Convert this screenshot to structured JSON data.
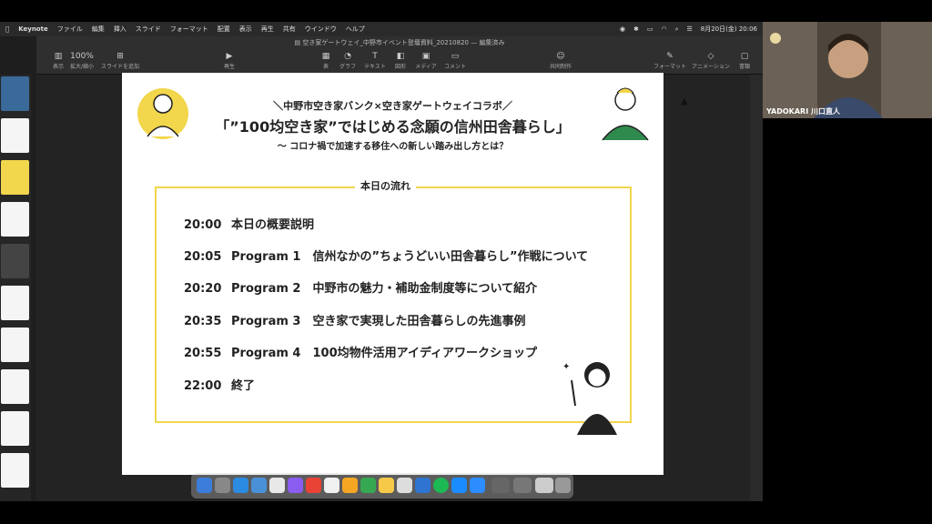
{
  "menubar": {
    "app_name": "Keynote",
    "items": [
      "ファイル",
      "編集",
      "挿入",
      "スライド",
      "フォーマット",
      "配置",
      "表示",
      "再生",
      "共有",
      "ウインドウ",
      "ヘルプ"
    ],
    "datetime": "8月20日(金) 20:06"
  },
  "window": {
    "title": "空き家ゲートウェイ_中野市イベント登壇資料_20210820",
    "edited": "— 編集済み"
  },
  "toolbar": {
    "zoom": "100%",
    "items": [
      {
        "icon": "sidebar-icon",
        "label": "表示"
      },
      {
        "icon": "zoom-icon",
        "label": "拡大/縮小"
      },
      {
        "icon": "add-slide-icon",
        "label": "スライドを追加"
      },
      {
        "icon": "play-icon",
        "label": "再生"
      },
      {
        "icon": "table-icon",
        "label": "表"
      },
      {
        "icon": "chart-icon",
        "label": "グラフ"
      },
      {
        "icon": "text-icon",
        "label": "テキスト"
      },
      {
        "icon": "shape-icon",
        "label": "図形"
      },
      {
        "icon": "media-icon",
        "label": "メディア"
      },
      {
        "icon": "comment-icon",
        "label": "コメント"
      },
      {
        "icon": "collaborate-icon",
        "label": "共同制作"
      },
      {
        "icon": "format-icon",
        "label": "フォーマット"
      },
      {
        "icon": "animate-icon",
        "label": "アニメーション"
      },
      {
        "icon": "document-icon",
        "label": "書類"
      }
    ]
  },
  "slide": {
    "subtitle_top": "＼中野市空き家バンク×空き家ゲートウェイコラボ／",
    "title": "「”100均空き家”ではじめる念願の信州田舎暮らし」",
    "subtitle_bottom": "〜 コロナ禍で加速する移住への新しい踏み出し方とは？",
    "section_title": "本日の流れ",
    "schedule": [
      {
        "time": "20:00",
        "text": "本日の概要説明"
      },
      {
        "time": "20:05",
        "text": "Program 1　信州なかの”ちょうどいい田舎暮らし”作戦について"
      },
      {
        "time": "20:20",
        "text": "Program 2　中野市の魅力・補助金制度等について紹介"
      },
      {
        "time": "20:35",
        "text": "Program 3　空き家で実現した田舎暮らしの先進事例"
      },
      {
        "time": "20:55",
        "text": "Program 4　100均物件活用アイディアワークショップ"
      },
      {
        "time": "22:00",
        "text": "終了"
      }
    ]
  },
  "webcam": {
    "name_label": "YADOKARI 川口直人"
  },
  "colors": {
    "accent_yellow": "#f2d64b",
    "slide_bg": "#ffffff",
    "app_bg": "#1e1e1e"
  }
}
